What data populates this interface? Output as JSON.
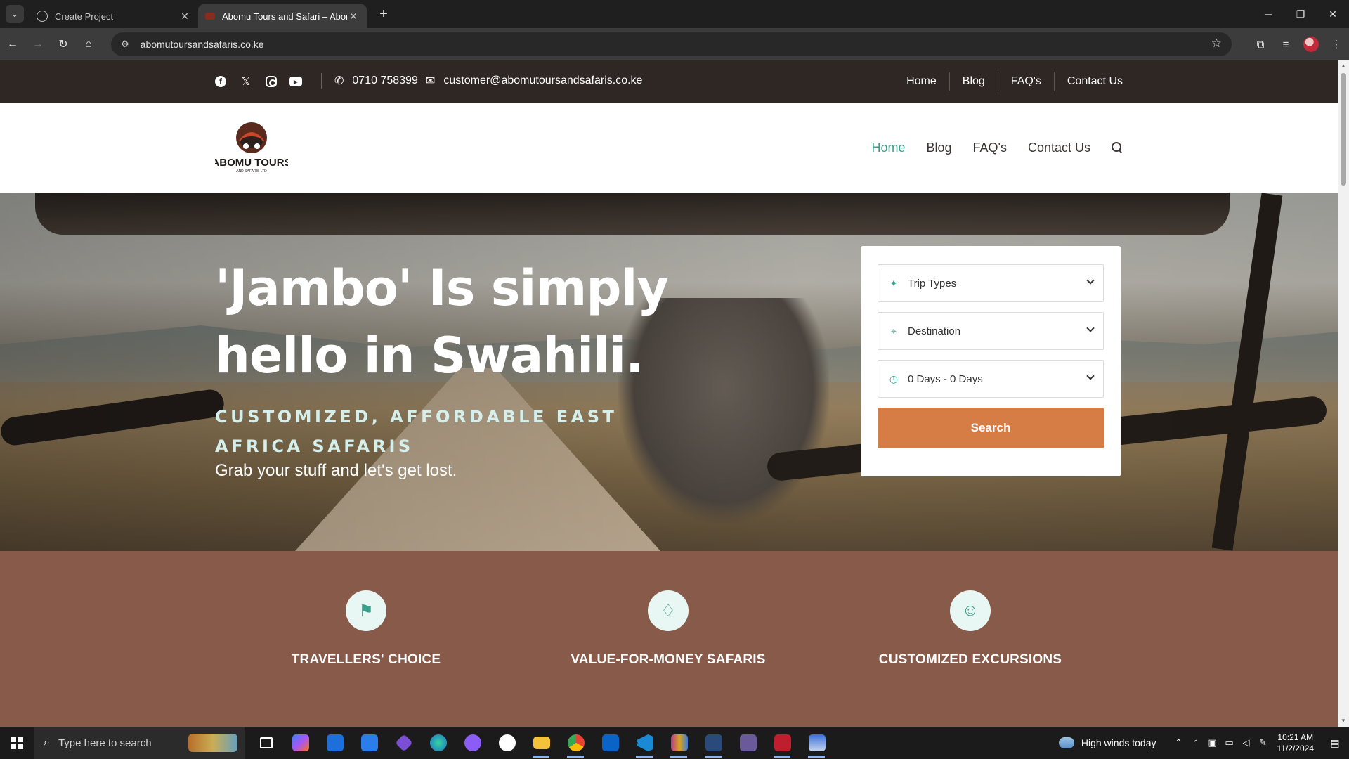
{
  "browser": {
    "tabs": [
      {
        "title": "Create Project",
        "active": false
      },
      {
        "title": "Abomu Tours and Safari – Abomu",
        "active": true
      }
    ],
    "url": "abomutoursandsafaris.co.ke"
  },
  "topbar": {
    "phone": "0710 758399",
    "email": "customer@abomutoursandsafaris.co.ke",
    "nav": [
      "Home",
      "Blog",
      "FAQ's",
      "Contact Us"
    ]
  },
  "header": {
    "logo_text": "ABOMU TOURS",
    "logo_subtext": "AND SAFARIS LTD",
    "nav": [
      "Home",
      "Blog",
      "FAQ's",
      "Contact Us"
    ],
    "active_nav": "Home",
    "accent_color": "#3aa08c"
  },
  "hero": {
    "title": "'Jambo' Is simply hello in Swahili.",
    "subtitle": "CUSTOMIZED, AFFORDABLE EAST AFRICA SAFARIS",
    "tagline": "Grab your stuff and let's get lost."
  },
  "search_form": {
    "trip_types": "Trip Types",
    "destination": "Destination",
    "duration": "0 Days - 0 Days",
    "button": "Search",
    "button_color": "#d57d45"
  },
  "features": [
    {
      "icon": "flag-icon",
      "label": "TRAVELLERS' CHOICE"
    },
    {
      "icon": "balloon-icon",
      "label": "VALUE-FOR-MONEY SAFARIS"
    },
    {
      "icon": "smile-icon",
      "label": "CUSTOMIZED EXCURSIONS"
    }
  ],
  "taskbar": {
    "search_placeholder": "Type here to search",
    "weather": "High winds today",
    "time": "10:21 AM",
    "date": "11/2/2024"
  }
}
